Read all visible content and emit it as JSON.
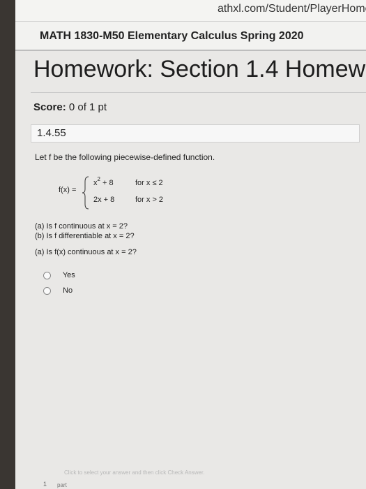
{
  "browser": {
    "url_fragment": "athxl.com/Student/PlayerHomework.aspx?hom"
  },
  "course": {
    "title": "MATH 1830-M50 Elementary Calculus Spring 2020"
  },
  "homework": {
    "title": "Homework: Section 1.4 Homew"
  },
  "score": {
    "label": "Score:",
    "value": "0 of 1 pt"
  },
  "question": {
    "number": "1.4.55",
    "prompt": "Let f be the following piecewise-defined function.",
    "function": {
      "name": "f(x) =",
      "piece1_expr": "x",
      "piece1_exp": "2",
      "piece1_rest": " + 8",
      "piece1_cond": "for x ≤ 2",
      "piece2_expr": "2x + 8",
      "piece2_cond": "for x > 2"
    },
    "part_a": "(a) Is f continuous at x = 2?",
    "part_b": "(b) Is f differentiable at x = 2?",
    "current_question": "(a) Is f(x) continuous at x = 2?",
    "options": [
      "Yes",
      "No"
    ],
    "hint": "Click to select your answer and then click Check Answer.",
    "footer_num": "1",
    "footer_text": "part"
  }
}
